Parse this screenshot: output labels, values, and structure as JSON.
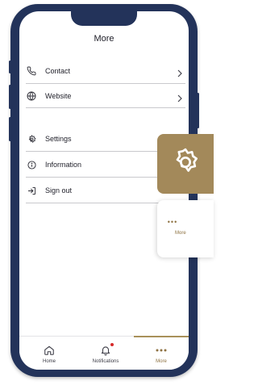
{
  "header": {
    "title": "More"
  },
  "menu": {
    "contact_label": "Contact",
    "website_label": "Website",
    "settings_label": "Settings",
    "information_label": "Information",
    "signout_label": "Sign out"
  },
  "tabbar": {
    "home_label": "Home",
    "notifications_label": "Notifications",
    "more_label": "More",
    "active": "More"
  },
  "overlay": {
    "more_dots": "•••",
    "more_label": "More"
  },
  "colors": {
    "frame": "#23335a",
    "accent": "#a3895a",
    "notification_dot": "#d62a2a"
  },
  "icons": [
    "phone-icon",
    "globe-icon",
    "gear-icon",
    "info-icon",
    "sign-out-icon",
    "chevron-right-icon",
    "home-icon",
    "bell-icon",
    "more-dots-icon"
  ]
}
